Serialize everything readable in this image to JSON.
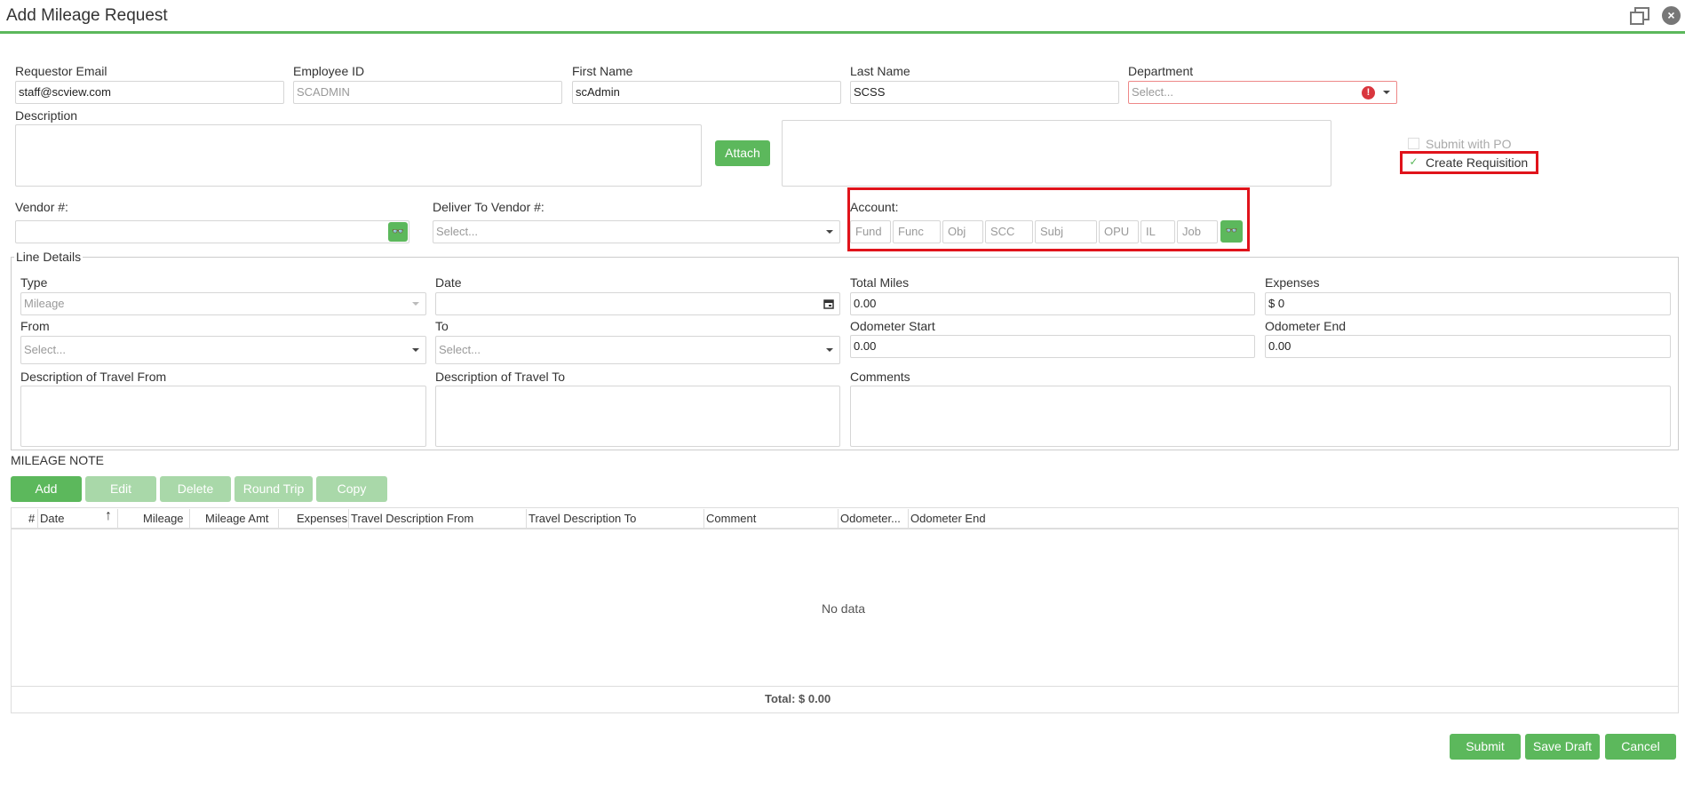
{
  "window": {
    "title": "Add Mileage Request",
    "close_symbol": "×"
  },
  "header_fields": {
    "requestor_email": {
      "label": "Requestor Email",
      "value": "staff@scview.com"
    },
    "employee_id": {
      "label": "Employee ID",
      "value": "SCADMIN"
    },
    "first_name": {
      "label": "First Name",
      "value": "scAdmin"
    },
    "last_name": {
      "label": "Last Name",
      "value": "SCSS"
    },
    "department": {
      "label": "Department",
      "placeholder": "Select...",
      "error_symbol": "!"
    }
  },
  "description": {
    "label": "Description"
  },
  "attach_button": "Attach",
  "checkboxes": {
    "submit_with_po": {
      "label": "Submit with PO",
      "checked": false
    },
    "create_requisition": {
      "label": "Create Requisition",
      "checked": true,
      "check_symbol": "✓"
    }
  },
  "vendor": {
    "label": "Vendor #:",
    "value": ""
  },
  "deliver_to_vendor": {
    "label": "Deliver To Vendor #:",
    "placeholder": "Select..."
  },
  "account": {
    "label": "Account:",
    "segments": [
      "Fund",
      "Func",
      "Obj",
      "SCC",
      "Subj",
      "OPU",
      "IL",
      "Job"
    ]
  },
  "binoculars_symbol": "👓",
  "line_details": {
    "legend": "Line Details",
    "type": {
      "label": "Type",
      "value": "Mileage"
    },
    "date": {
      "label": "Date",
      "value": ""
    },
    "total_miles": {
      "label": "Total Miles",
      "value": "0.00"
    },
    "expenses": {
      "label": "Expenses",
      "value": "$ 0"
    },
    "from": {
      "label": "From",
      "placeholder": "Select..."
    },
    "to": {
      "label": "To",
      "placeholder": "Select..."
    },
    "odometer_start": {
      "label": "Odometer Start",
      "value": "0.00"
    },
    "odometer_end": {
      "label": "Odometer End",
      "value": "0.00"
    },
    "desc_from": {
      "label": "Description of Travel From"
    },
    "desc_to": {
      "label": "Description of Travel To"
    },
    "comments": {
      "label": "Comments"
    }
  },
  "mileage_note": "MILEAGE NOTE",
  "grid_buttons": {
    "add": "Add",
    "edit": "Edit",
    "delete": "Delete",
    "round_trip": "Round Trip",
    "copy": "Copy"
  },
  "grid": {
    "columns": [
      "#",
      "Date",
      "Mileage",
      "Mileage Amt",
      "Expenses",
      "Travel Description From",
      "Travel Description To",
      "Comment",
      "Odometer...",
      "Odometer End"
    ],
    "sort_symbol": "↑",
    "empty_text": "No data",
    "total": "Total: $ 0.00"
  },
  "footer_buttons": {
    "submit": "Submit",
    "save_draft": "Save Draft",
    "cancel": "Cancel"
  },
  "colors": {
    "accent": "#5cb85c",
    "highlight": "#e0131b",
    "error": "#d9363e"
  }
}
